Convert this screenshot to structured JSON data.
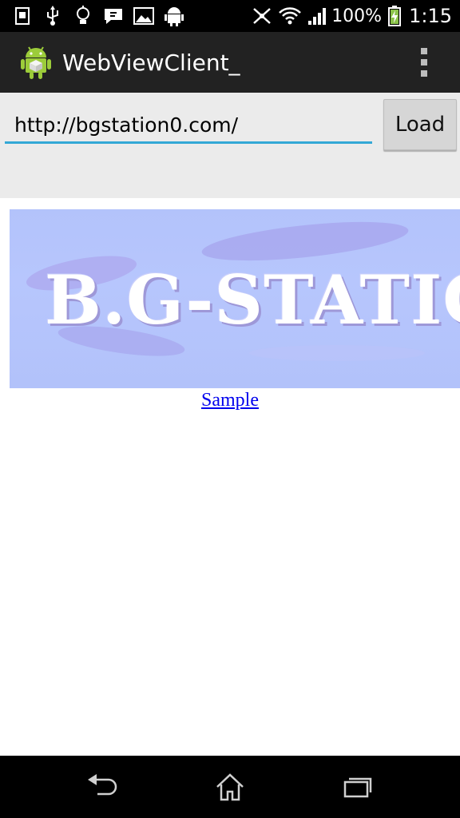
{
  "status_bar": {
    "left_icons": [
      "sim-card-icon",
      "usb-icon",
      "lightbulb-icon",
      "chat-icon",
      "gallery-icon",
      "android-debug-icon"
    ],
    "right_icons": [
      "no-nfc-icon",
      "wifi-icon",
      "signal-icon",
      "battery-charging-icon"
    ],
    "battery_percent": "100%",
    "time": "1:15"
  },
  "action_bar": {
    "title": "WebViewClient_",
    "app_icon": "android-app-icon",
    "overflow_icon": "overflow-menu-icon"
  },
  "url_bar": {
    "value": "http://bgstation0.com/",
    "load_label": "Load"
  },
  "web_page": {
    "banner_text": "B.G-STATIO",
    "link_text": "Sample"
  },
  "nav_bar": {
    "icons": [
      "back-icon",
      "home-icon",
      "recent-apps-icon"
    ]
  },
  "colors": {
    "status_bar_bg": "#000000",
    "action_bar_bg": "#222222",
    "url_area_bg": "#ebebeb",
    "input_underline": "#33a8d6",
    "button_bg": "#d6d6d6",
    "banner_bg": "#b3c3fb",
    "link": "#0000ee"
  }
}
